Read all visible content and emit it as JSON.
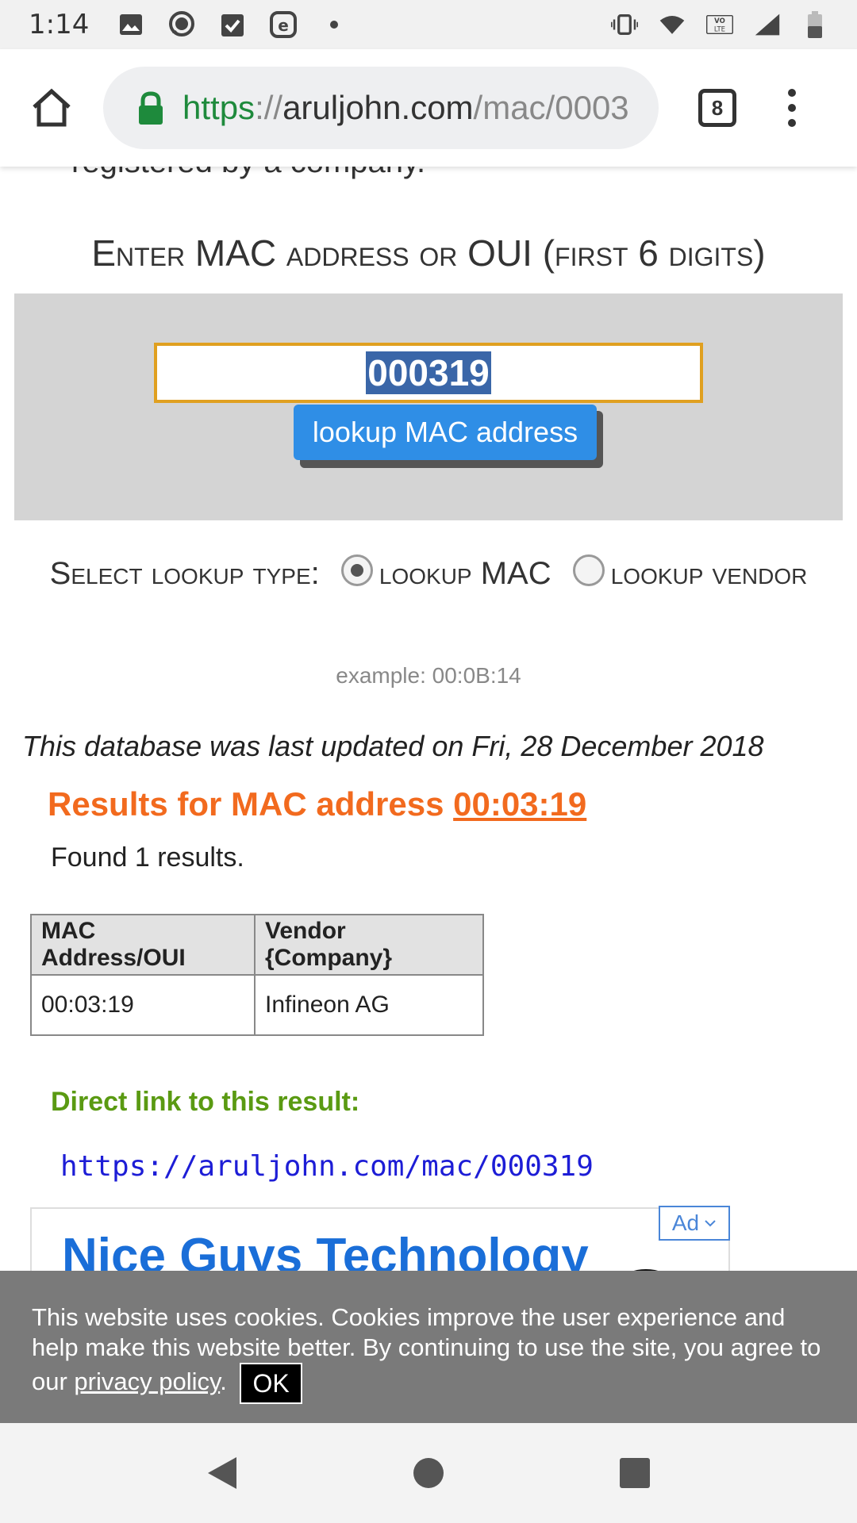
{
  "status": {
    "time": "1:14",
    "lte_label": "VO LTE",
    "left_icons": [
      "image-icon",
      "chat-bubble-icon",
      "task-check-icon",
      "e-circle-icon",
      "dot-icon"
    ],
    "right_icons": [
      "vibrate-icon",
      "wifi-icon",
      "volte-icon",
      "cell-signal-icon",
      "battery-icon"
    ]
  },
  "browser": {
    "url_scheme": "https",
    "url_sep": "://",
    "url_host": "aruljohn.com",
    "url_path": "/mac/0003",
    "tab_count": "8"
  },
  "page": {
    "cut_text": "registered by a company.",
    "enter_heading": "Enter MAC address or OUI (first 6 digits)",
    "input_value": "000319",
    "lookup_button": "lookup MAC address",
    "select_label": "Select lookup type:",
    "radio_mac_label": "lookup MAC",
    "radio_vendor_label": "lookup vendor",
    "example": "example: 00:0B:14",
    "updated": "This database was last updated on Fri, 28 December 2018",
    "results_prefix": "Results for MAC address ",
    "results_mac": "00:03:19",
    "found": "Found 1 results.",
    "table": {
      "headers": [
        "MAC Address/OUI",
        "Vendor {Company}"
      ],
      "rows": [
        [
          "00:03:19",
          "Infineon AG"
        ]
      ]
    },
    "direct_label": "Direct link to this result:",
    "direct_url": "https://aruljohn.com/mac/000319"
  },
  "ad": {
    "title": "Nice Guys Technology",
    "badge": "Ad"
  },
  "cookie": {
    "text_before": "This website uses cookies. Cookies improve the user experience and help make this website better. By continuing to use the site, you agree to our ",
    "link": "privacy policy",
    "text_after": ".",
    "ok": "OK"
  },
  "colors": {
    "accent_orange": "#f26a1e",
    "link_green": "#5a9a12",
    "button_blue": "#2f8ee6",
    "url_blue": "#1d1dd6"
  }
}
